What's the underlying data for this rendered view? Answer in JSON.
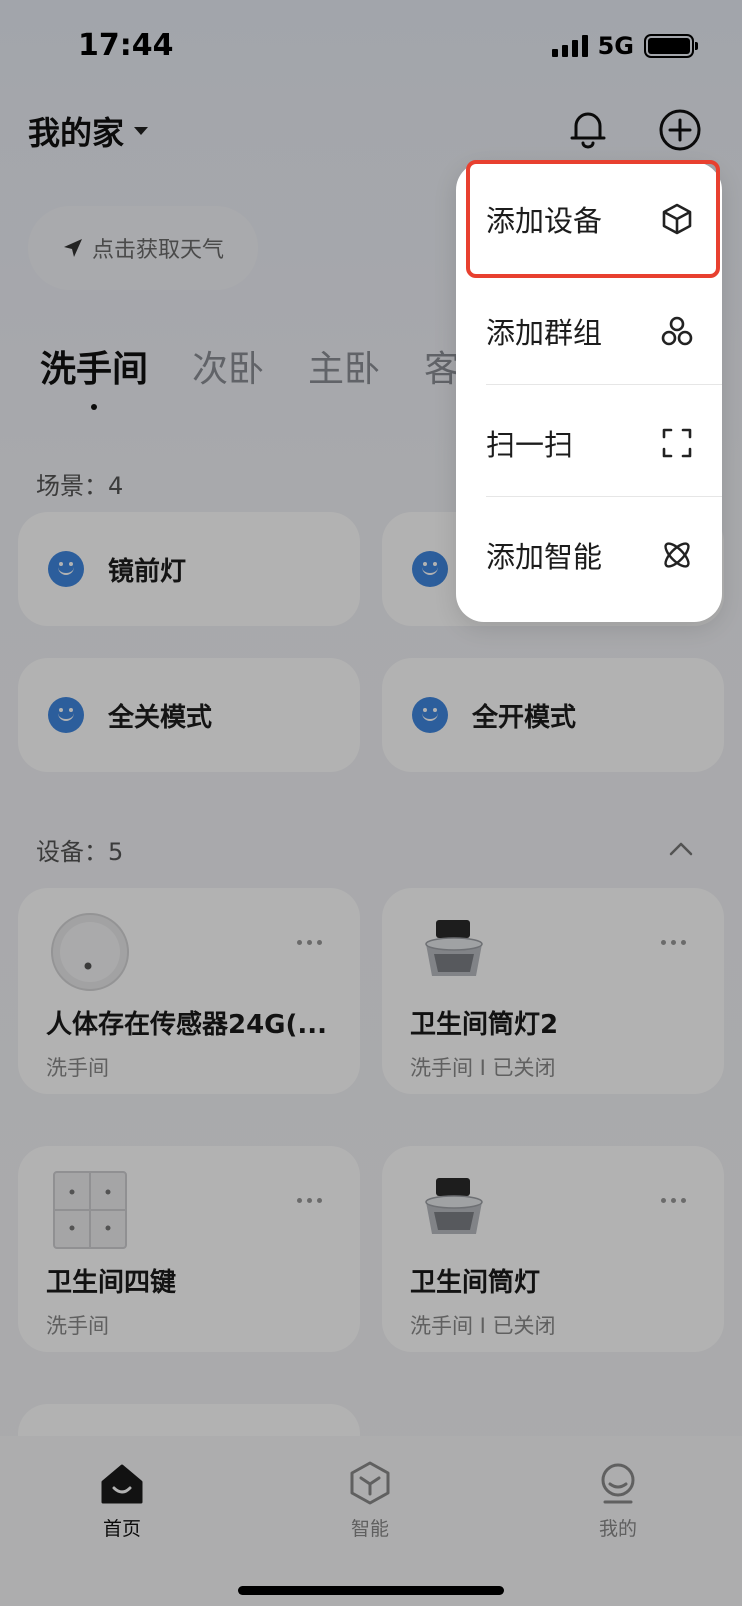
{
  "status_bar": {
    "time": "17:44",
    "network": "5G"
  },
  "header": {
    "home_name": "我的家",
    "bell_icon": "bell-icon",
    "add_icon": "plus-circle-icon"
  },
  "weather": {
    "label": "点击获取天气",
    "icon": "location-arrow-icon"
  },
  "room_tabs": [
    {
      "label": "洗手间",
      "active": true
    },
    {
      "label": "次卧",
      "active": false
    },
    {
      "label": "主卧",
      "active": false
    },
    {
      "label": "客",
      "active": false
    }
  ],
  "scenes": {
    "label": "场景：4",
    "items": [
      {
        "label": "镜前灯"
      },
      {
        "label": ""
      },
      {
        "label": "全关模式"
      },
      {
        "label": "全开模式"
      }
    ]
  },
  "devices": {
    "label": "设备：5",
    "items": [
      {
        "name": "人体存在传感器24G(...",
        "sub": "洗手间",
        "icon": "presence-sensor-icon"
      },
      {
        "name": "卫生间筒灯2",
        "sub": "洗手间 I 已关闭",
        "icon": "downlight-icon"
      },
      {
        "name": "卫生间四键",
        "sub": "洗手间",
        "icon": "four-key-switch-icon"
      },
      {
        "name": "卫生间筒灯",
        "sub": "洗手间 I 已关闭",
        "icon": "downlight-icon"
      }
    ]
  },
  "menu": {
    "items": [
      {
        "label": "添加设备",
        "icon": "cube-icon"
      },
      {
        "label": "添加群组",
        "icon": "group-icon"
      },
      {
        "label": "扫一扫",
        "icon": "scan-icon"
      },
      {
        "label": "添加智能",
        "icon": "atom-icon"
      }
    ],
    "highlight_color": "#e8402f"
  },
  "bottom_nav": [
    {
      "label": "首页",
      "icon": "home-icon",
      "active": true
    },
    {
      "label": "智能",
      "icon": "smart-hex-icon",
      "active": false
    },
    {
      "label": "我的",
      "icon": "profile-icon",
      "active": false
    }
  ],
  "colors": {
    "accent": "#3f87e0",
    "highlight": "#e8402f"
  }
}
